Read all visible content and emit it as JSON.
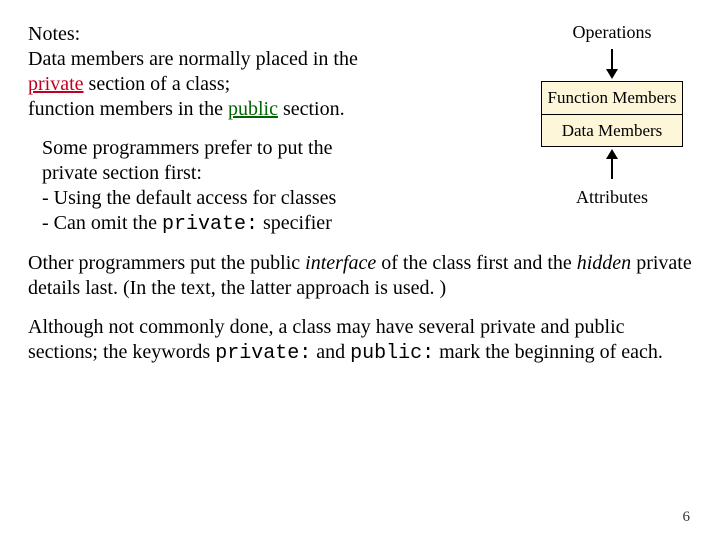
{
  "notes": {
    "title": "Notes:",
    "line1a": "Data members are normally placed in the ",
    "private_word": "private",
    "line1b": " section of a class;",
    "line2a": "function members in the ",
    "public_word": "public",
    "line2b": " section."
  },
  "diagram": {
    "operations_label": "Operations",
    "function_members": "Function Members",
    "data_members": "Data Members",
    "attributes_label": "Attributes"
  },
  "prefer": {
    "line1": "Some programmers prefer to put the",
    "line2": "private section  first:",
    "bullet1": " - Using the default access for classes",
    "bullet2a": " - Can omit the ",
    "private_spec": "private:",
    "bullet2b": " specifier"
  },
  "other": {
    "part1": "Other programmers put the public ",
    "interface_word": "interface",
    "part2": " of the class first and the ",
    "hidden_word": "hidden",
    "part3": " private details last.  (In the text, the latter approach is used. )"
  },
  "although": {
    "part1": "Although not commonly done, a class may have several private and public sections;  the keywords ",
    "kw_private": "private:",
    "mid": " and ",
    "kw_public": "public:",
    "part2": " mark the beginning of each."
  },
  "page_number": "6"
}
